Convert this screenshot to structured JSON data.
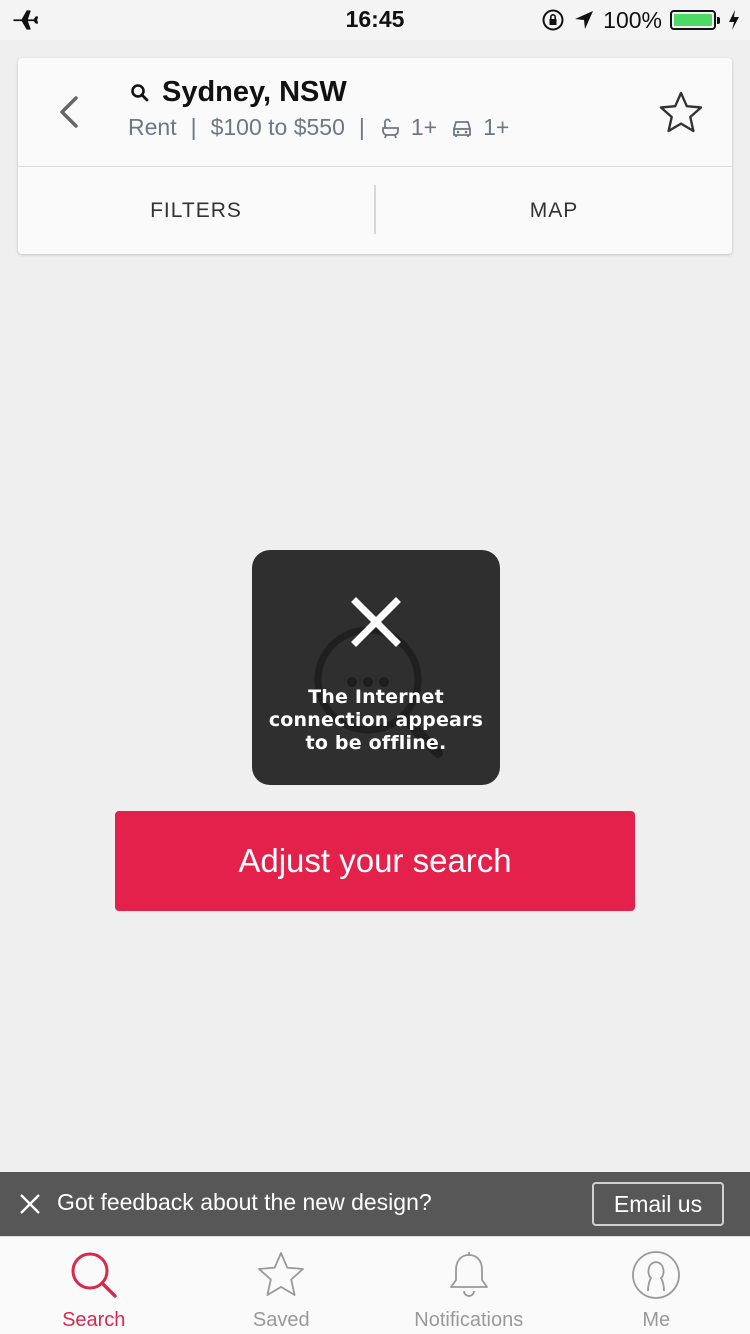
{
  "status_bar": {
    "time": "16:45",
    "battery": "100%",
    "battery_color": "#4cd964"
  },
  "search_header": {
    "location": "Sydney, NSW",
    "criteria": {
      "listing_type": "Rent",
      "price": "$100 to $550",
      "separator": "|",
      "bathrooms": "1+",
      "parking": "1+"
    },
    "icons": [
      "back-chevron-icon",
      "search-icon",
      "bath-icon",
      "car-icon",
      "star-outline-icon"
    ],
    "tabs": [
      {
        "label": "FILTERS"
      },
      {
        "label": "MAP"
      }
    ]
  },
  "toast": {
    "message": "The Internet connection appears to be offline.",
    "icon": "close-x-icon"
  },
  "adjust_button": {
    "label": "Adjust your search",
    "color": "#e4214a"
  },
  "feedback_bar": {
    "text": "Got feedback about the new design?",
    "button": "Email us"
  },
  "tab_bar": {
    "active_color": "#d8294d",
    "items": [
      {
        "label": "Search",
        "icon": "search-icon",
        "active": true
      },
      {
        "label": "Saved",
        "icon": "star-icon",
        "active": false
      },
      {
        "label": "Notifications",
        "icon": "bell-icon",
        "active": false
      },
      {
        "label": "Me",
        "icon": "user-icon",
        "active": false
      }
    ]
  }
}
